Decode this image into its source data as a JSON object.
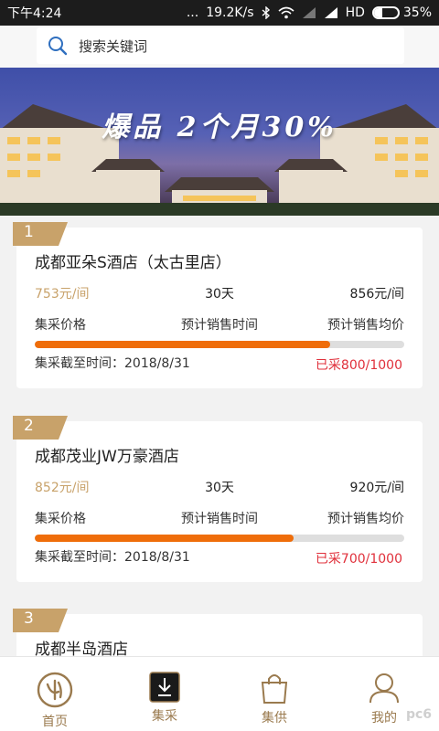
{
  "status_bar": {
    "time": "下午4:24",
    "dots": "...",
    "network_speed": "19.2K/s",
    "network_type": "HD",
    "battery": "35%",
    "battery_level": 0.35
  },
  "search": {
    "placeholder": "搜索关键词"
  },
  "banner": {
    "title": "爆品  2个月30%"
  },
  "items": [
    {
      "rank": "1",
      "name": "成都亚朵S酒店（太古里店）",
      "group_price": "753元/间",
      "sale_period": "30天",
      "avg_price": "856元/间",
      "label_price": "集采价格",
      "label_period": "预计销售时间",
      "label_avg": "预计销售均价",
      "deadline_label": "集采截至时间：",
      "deadline": "2018/8/31",
      "sold": "已采800/1000",
      "progress": 0.8
    },
    {
      "rank": "2",
      "name": "成都茂业JW万豪酒店",
      "group_price": "852元/间",
      "sale_period": "30天",
      "avg_price": "920元/间",
      "label_price": "集采价格",
      "label_period": "预计销售时间",
      "label_avg": "预计销售均价",
      "deadline_label": "集采截至时间：",
      "deadline": "2018/8/31",
      "sold": "已采700/1000",
      "progress": 0.7
    },
    {
      "rank": "3",
      "name": "成都半岛酒店"
    }
  ],
  "nav": [
    {
      "label": "首页",
      "icon": "home-logo-icon"
    },
    {
      "label": "集采",
      "icon": "download-icon"
    },
    {
      "label": "集供",
      "icon": "shopping-bag-icon"
    },
    {
      "label": "我的",
      "icon": "user-icon"
    }
  ],
  "colors": {
    "accent": "#c8a26a",
    "progress": "#ef6d0a",
    "sold": "#e0303b"
  },
  "watermark": "pc6"
}
